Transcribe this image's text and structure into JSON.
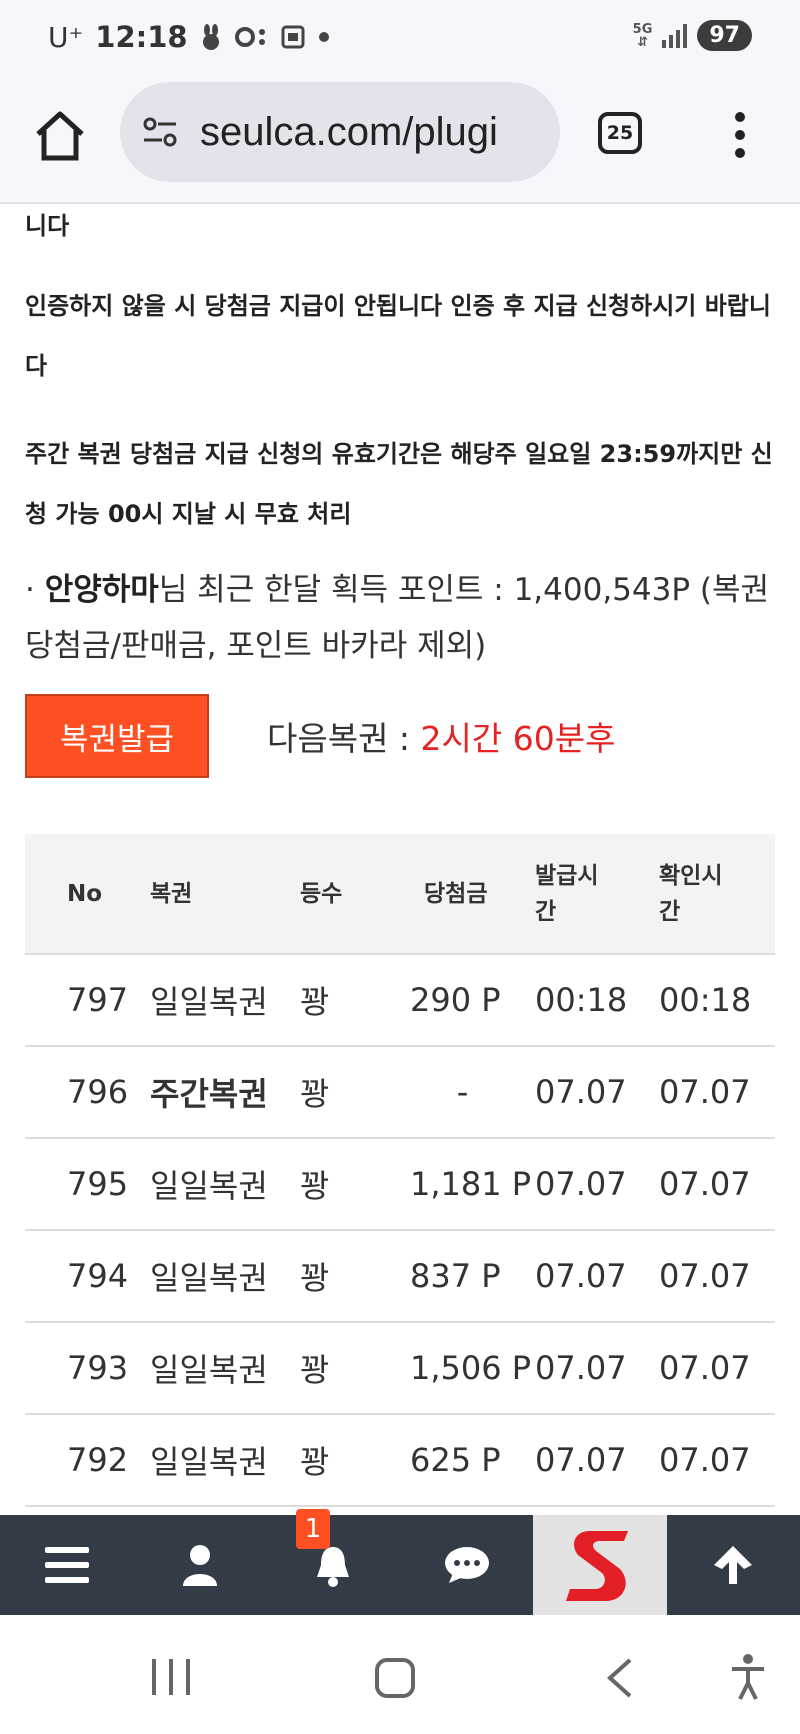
{
  "status_bar": {
    "carrier": "U⁺",
    "time": "12:18",
    "network": "5G",
    "battery": "97"
  },
  "browser": {
    "url": "seulca.com/plugi",
    "tab_count": "25"
  },
  "notices": {
    "line0": "니다",
    "line1": "인증하지 않을 시 당첨금 지급이 안됩니다 인증 후 지급 신청하시기 바랍니다",
    "line2": "주간 복권 당첨금 지급 신청의 유효기간은 해당주 일요일 23:59까지만 신청 가능 00시 지날 시 무효 처리"
  },
  "points": {
    "bullet": "·",
    "username": "안양하마",
    "text": "님 최근 한달 획득 포인트 : 1,400,543P (복권 당첨금/판매금, 포인트 바카라 제외)"
  },
  "issue_button": "복권발급",
  "next_lottery": {
    "label": "다음복권 : ",
    "value": "2시간 60분후"
  },
  "table": {
    "headers": [
      "No",
      "복권",
      "등수",
      "당첨금",
      "발급시간",
      "확인시간"
    ],
    "rows": [
      {
        "no": "797",
        "name": "일일복권",
        "rank": "꽝",
        "prize": "290 P",
        "issued": "00:18",
        "checked": "00:18"
      },
      {
        "no": "796",
        "name": "주간복권",
        "rank": "꽝",
        "prize": "-",
        "issued": "07.07",
        "checked": "07.07"
      },
      {
        "no": "795",
        "name": "일일복권",
        "rank": "꽝",
        "prize": "1,181 P",
        "issued": "07.07",
        "checked": "07.07"
      },
      {
        "no": "794",
        "name": "일일복권",
        "rank": "꽝",
        "prize": "837 P",
        "issued": "07.07",
        "checked": "07.07"
      },
      {
        "no": "793",
        "name": "일일복권",
        "rank": "꽝",
        "prize": "1,506 P",
        "issued": "07.07",
        "checked": "07.07"
      },
      {
        "no": "792",
        "name": "일일복권",
        "rank": "꽝",
        "prize": "625 P",
        "issued": "07.07",
        "checked": "07.07"
      }
    ]
  },
  "toolbar": {
    "notification_count": "1",
    "icons": [
      "menu-icon",
      "user-icon",
      "bell-icon",
      "chat-icon",
      "site-logo",
      "arrow-up-icon"
    ]
  },
  "colors": {
    "accent": "#ff5024",
    "next_value": "#e62222",
    "toolbar_bg": "#333c46"
  }
}
